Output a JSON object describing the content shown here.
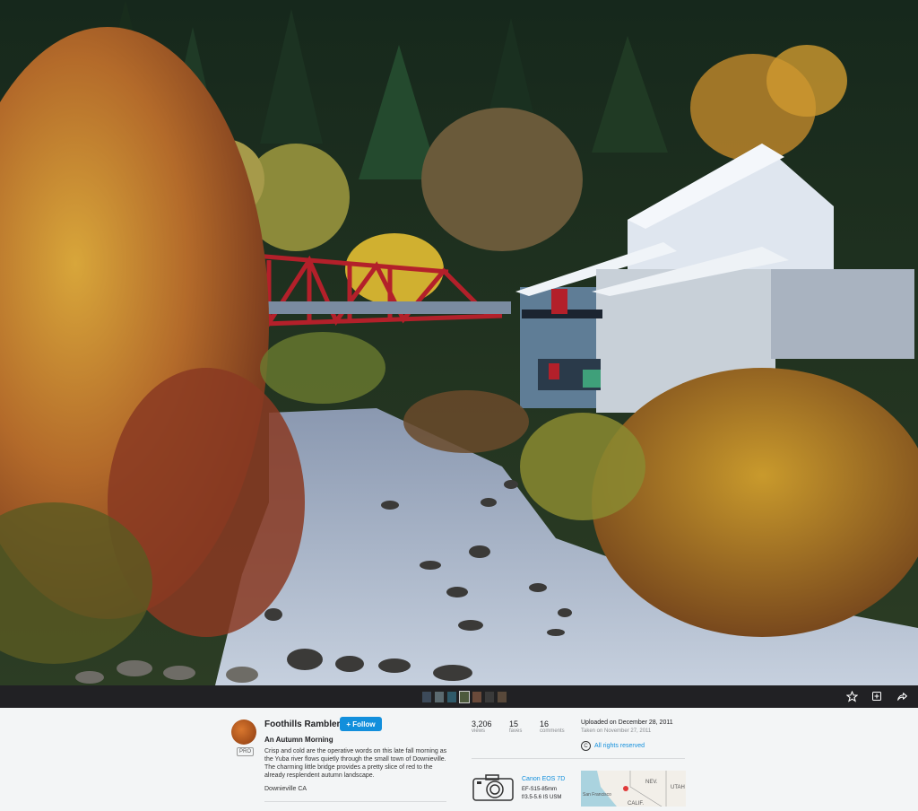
{
  "photo": {
    "icons": [
      "star-icon",
      "add-to-gallery-icon",
      "share-icon"
    ]
  },
  "filmstrip": {
    "thumbnail_count": 7
  },
  "author": {
    "name": "Foothills Rambler",
    "badge": "PRO",
    "follow_label": "+ Follow"
  },
  "details": {
    "title": "An Autumn Morning",
    "description": "Crisp and cold are the operative words on this late fall morning as the Yuba river flows quietly through the small town of Downieville. The charming little bridge provides a pretty slice of red to the already resplendent autumn landscape.",
    "location": "Downieville CA"
  },
  "stats": [
    {
      "value": "3,206",
      "label": "views"
    },
    {
      "value": "15",
      "label": "faves"
    },
    {
      "value": "16",
      "label": "comments"
    }
  ],
  "dates": {
    "uploaded": "Uploaded on December 28, 2011",
    "taken": "Taken on November 27, 2011"
  },
  "license": {
    "label": "All rights reserved",
    "icon": "copyright-icon"
  },
  "camera": {
    "model": "Canon EOS 7D",
    "lens": "EF-S15-85mm",
    "aperture": "f/3.5-5.6 IS USM",
    "icon": "camera-icon"
  },
  "map": {
    "labels": [
      "NEV.",
      "UTAH",
      "San Francisco",
      "CALIF."
    ]
  },
  "colors": {
    "accent": "#128fdc",
    "toolbar_bg": "#212124",
    "panel_bg": "#f3f5f6",
    "bridge_red": "#b3202a"
  }
}
